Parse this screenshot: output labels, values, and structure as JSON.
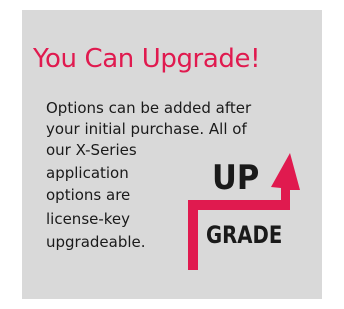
{
  "panel": {
    "title": "You Can Upgrade!",
    "description_lines": [
      "Options can be added after",
      "your initial purchase. All of",
      "our X-Series",
      "application",
      "options are",
      "license-key",
      "upgradeable."
    ]
  },
  "graphic": {
    "up_label": "UP",
    "grade_label": "GRADE",
    "arrow_color": "#e01a4f"
  },
  "colors": {
    "accent": "#e01a4f",
    "panel_background": "#d9d9d9",
    "text": "#1a1a1a"
  }
}
